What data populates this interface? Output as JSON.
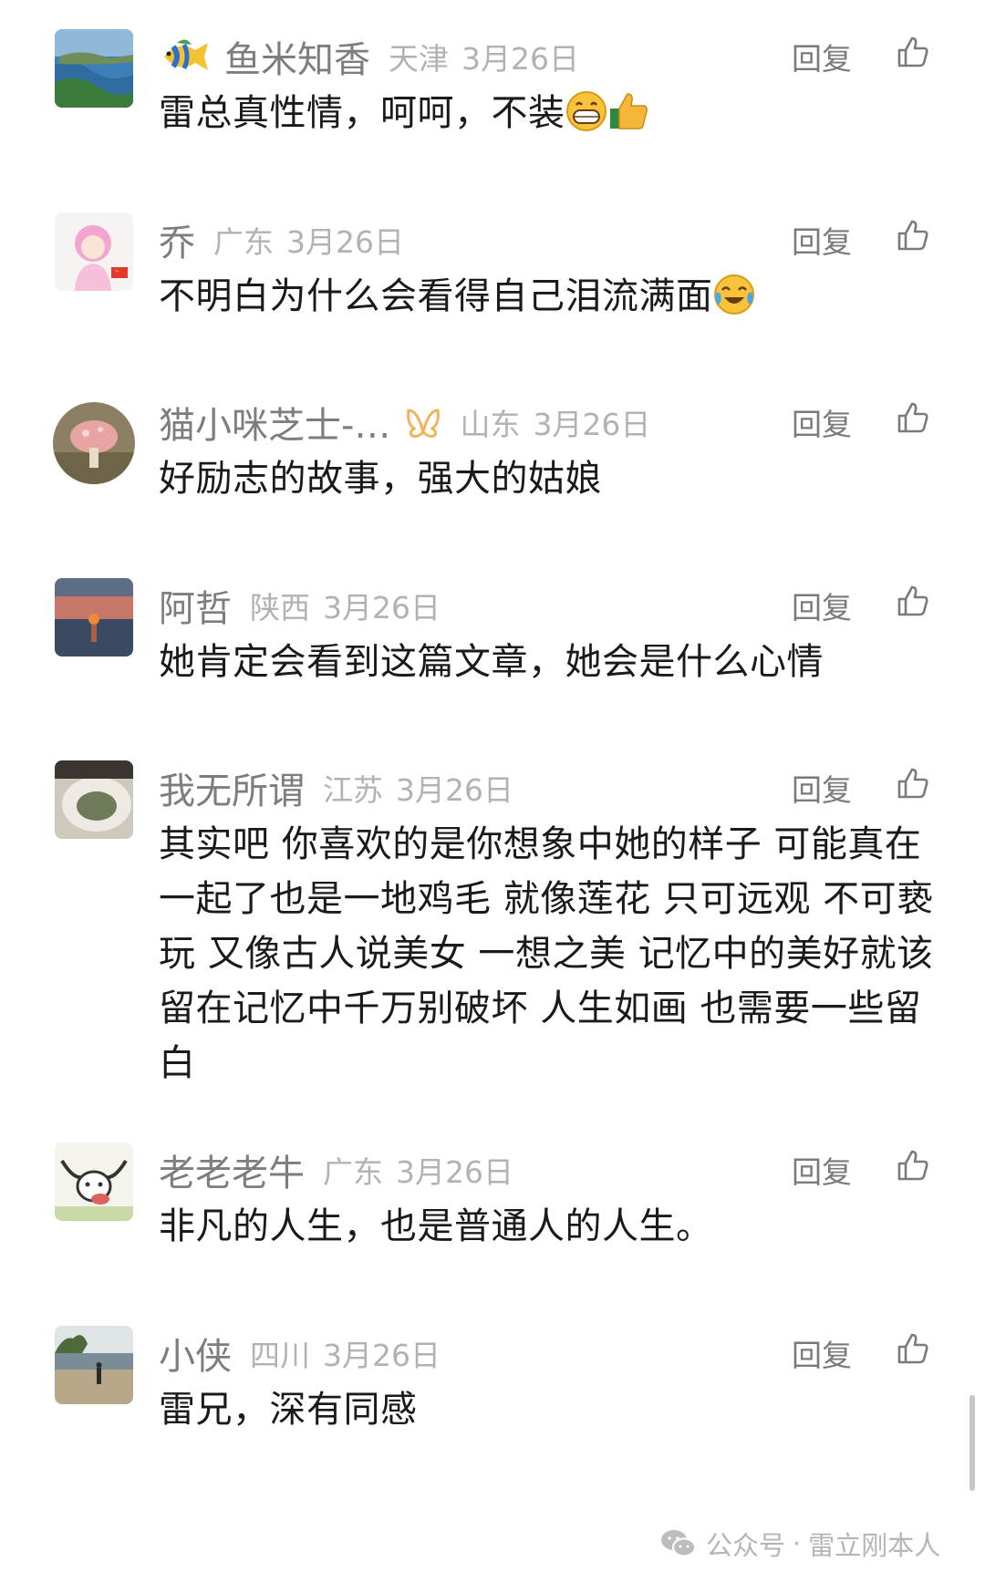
{
  "ui": {
    "reply_label": "回复"
  },
  "comments": [
    {
      "name": "鱼米知香",
      "region": "天津",
      "date": "3月26日",
      "text": "雷总真性情，呵呵，不装"
    },
    {
      "name": "乔",
      "region": "广东",
      "date": "3月26日",
      "text": "不明白为什么会看得自己泪流满面"
    },
    {
      "name": "猫小咪芝士-…",
      "region": "山东",
      "date": "3月26日",
      "text": "好励志的故事，强大的姑娘"
    },
    {
      "name": "阿哲",
      "region": "陕西",
      "date": "3月26日",
      "text": "她肯定会看到这篇文章，她会是什么心情"
    },
    {
      "name": "我无所谓",
      "region": "江苏",
      "date": "3月26日",
      "text": "其实吧 你喜欢的是你想象中她的样子 可能真在一起了也是一地鸡毛 就像莲花 只可远观 不可亵玩 又像古人说美女 一想之美  记忆中的美好就该留在记忆中千万别破坏 人生如画 也需要一些留白"
    },
    {
      "name": "老老老牛",
      "region": "广东",
      "date": "3月26日",
      "text": "非凡的人生，也是普通人的人生。"
    },
    {
      "name": "小侠",
      "region": "四川",
      "date": "3月26日",
      "text": "雷兄，深有同感"
    }
  ],
  "watermark": {
    "label": "公众号",
    "separator": "·",
    "account": "雷立刚本人"
  },
  "colors": {
    "name": "#7d7d7d",
    "meta": "#b2b2b2",
    "body_text": "#1a1a1a",
    "background": "#ffffff"
  },
  "icons": [
    "fish-emoji-icon",
    "butterfly-badge-icon",
    "thumbs-up-icon",
    "grin-emoji-icon",
    "thumbs-up-emoji-icon",
    "crying-laughing-emoji-icon",
    "wechat-icon"
  ]
}
